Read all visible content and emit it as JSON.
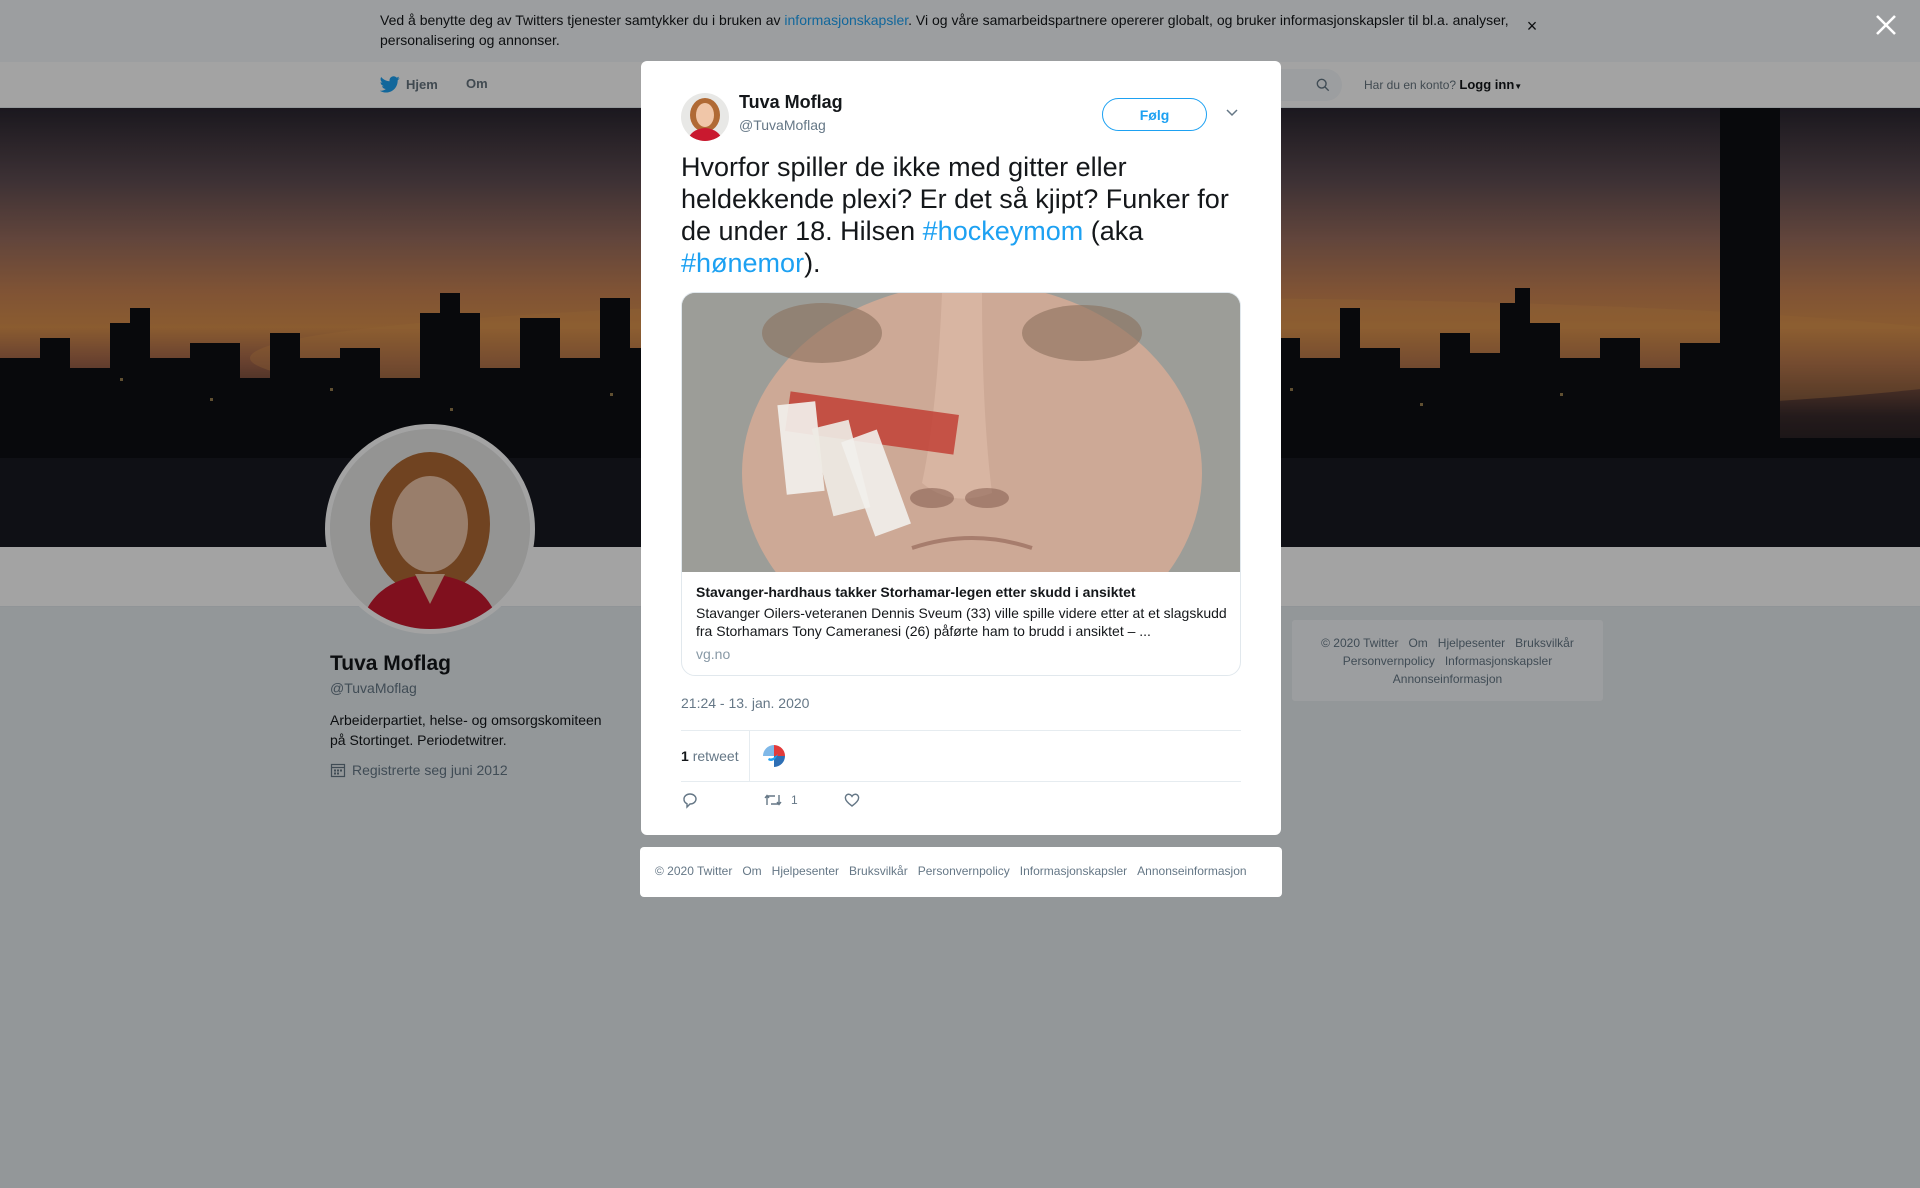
{
  "cookie_banner": {
    "text_before": "Ved å benytte deg av Twitters tjenester samtykker du i bruken av ",
    "link": "informasjonskapsler",
    "text_after": ". Vi og våre samarbeidspartnere opererer globalt, og bruker informasjonskapsler til bl.a. analyser, personalisering og annonser.",
    "dismiss": "×"
  },
  "nav": {
    "home": "Hjem",
    "about": "Om",
    "account_prompt": "Har du en konto?",
    "login": "Logg inn"
  },
  "profile": {
    "name": "Tuva Moflag",
    "handle": "@TuvaMoflag",
    "bio": "Arbeiderpartiet, helse- og omsorgskomiteen på Stortinget. Periodetwitrer.",
    "joined": "Registrerte seg juni 2012"
  },
  "side_footer": {
    "links": [
      "© 2020 Twitter",
      "Om",
      "Hjelpesenter",
      "Bruksvilkår",
      "Personvernpolicy",
      "Informasjonskapsler",
      "Annonseinformasjon"
    ]
  },
  "tweet": {
    "author_name": "Tuva Moflag",
    "author_handle": "@TuvaMoflag",
    "follow_label": "Følg",
    "text_part1": "Hvorfor spiller de ikke med gitter eller heldekkende plexi? Er det så kjipt? Funker for de under 18. Hilsen ",
    "hashtag1": "#hockeymom",
    "text_part2": " (aka ",
    "hashtag2": "#hønemor",
    "text_part3": ").",
    "card": {
      "title": "Stavanger-hardhaus takker Storhamar-legen etter skudd i ansiktet",
      "description": "Stavanger Oilers-veteranen Dennis Sveum (33) ville spille videre etter at et slagskudd fra Storhamars Tony Cameranesi (26) påførte ham to brudd i ansiktet – ...",
      "domain": "vg.no"
    },
    "timestamp": "21:24 - 13. jan. 2020",
    "retweet_count": "1",
    "retweet_label": "retweet",
    "action_retweet_count": "1"
  },
  "modal_footer": {
    "links": [
      "© 2020 Twitter",
      "Om",
      "Hjelpesenter",
      "Bruksvilkår",
      "Personvernpolicy",
      "Informasjonskapsler",
      "Annonseinformasjon"
    ]
  },
  "colors": {
    "accent": "#1da1f2",
    "text": "#14171a",
    "muted": "#657786",
    "page_bg": "#e6ecf0"
  },
  "icons": {
    "twitter_bird": "twitter-bird-icon",
    "search": "search-icon",
    "close": "close-icon",
    "calendar": "calendar-icon",
    "reply": "reply-icon",
    "retweet": "retweet-icon",
    "like": "heart-icon",
    "chevron": "chevron-down-icon"
  }
}
